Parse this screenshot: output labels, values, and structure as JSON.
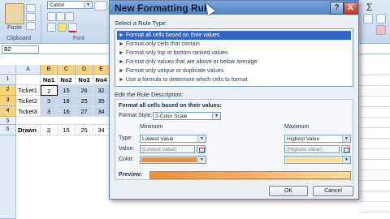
{
  "ribbon": {
    "paste_label": "Paste",
    "clipboard_label": "Clipboard",
    "font_name": "Calibri",
    "font_label": "Font",
    "sigma_symbol": "Σ"
  },
  "namebox": {
    "value": "B2"
  },
  "grid": {
    "columns": [
      "A",
      "B",
      "C",
      "D",
      "E"
    ],
    "rows": [
      "1",
      "2",
      "3",
      "4",
      "5",
      "6"
    ],
    "headers": [
      "No1",
      "No2",
      "No3",
      "No4"
    ],
    "data": [
      {
        "label": "Ticket1",
        "values": [
          "2",
          "15",
          "26",
          "32"
        ]
      },
      {
        "label": "Ticket2",
        "values": [
          "3",
          "18",
          "25",
          "35"
        ]
      },
      {
        "label": "Ticket3",
        "values": [
          "3",
          "16",
          "27",
          "34"
        ]
      }
    ],
    "drawn": {
      "label": "Drawn",
      "values": [
        "3",
        "15",
        "25",
        "34"
      ]
    }
  },
  "dialog": {
    "title": "New Formatting Rule",
    "help_label": "?",
    "close_label": "X",
    "select_rule_type_label": "Select a Rule Type:",
    "rule_types": [
      "► Format all cells based on their values",
      "► Format only cells that contain",
      "► Format only top or bottom ranked values",
      "► Format only values that are above or below average",
      "► Format only unique or duplicate values",
      "► Use a formula to determine which cells to format"
    ],
    "edit_description_label": "Edit the Rule Description:",
    "desc_heading": "Format all cells based on their values:",
    "format_style_label": "Format Style:",
    "format_style_value": "2-Color Scale",
    "minimum_label": "Minimum",
    "maximum_label": "Maximum",
    "type_label": "Type:",
    "value_label": "Value:",
    "color_label": "Color:",
    "min_type": "Lowest Value",
    "max_type": "Highest Value",
    "min_value_placeholder": "(Lowest value)",
    "max_value_placeholder": "(Highest value)",
    "min_color": "#f5893a",
    "max_color": "#fcdc92",
    "preview_label": "Preview:",
    "ok_label": "OK",
    "cancel_label": "Cancel"
  }
}
